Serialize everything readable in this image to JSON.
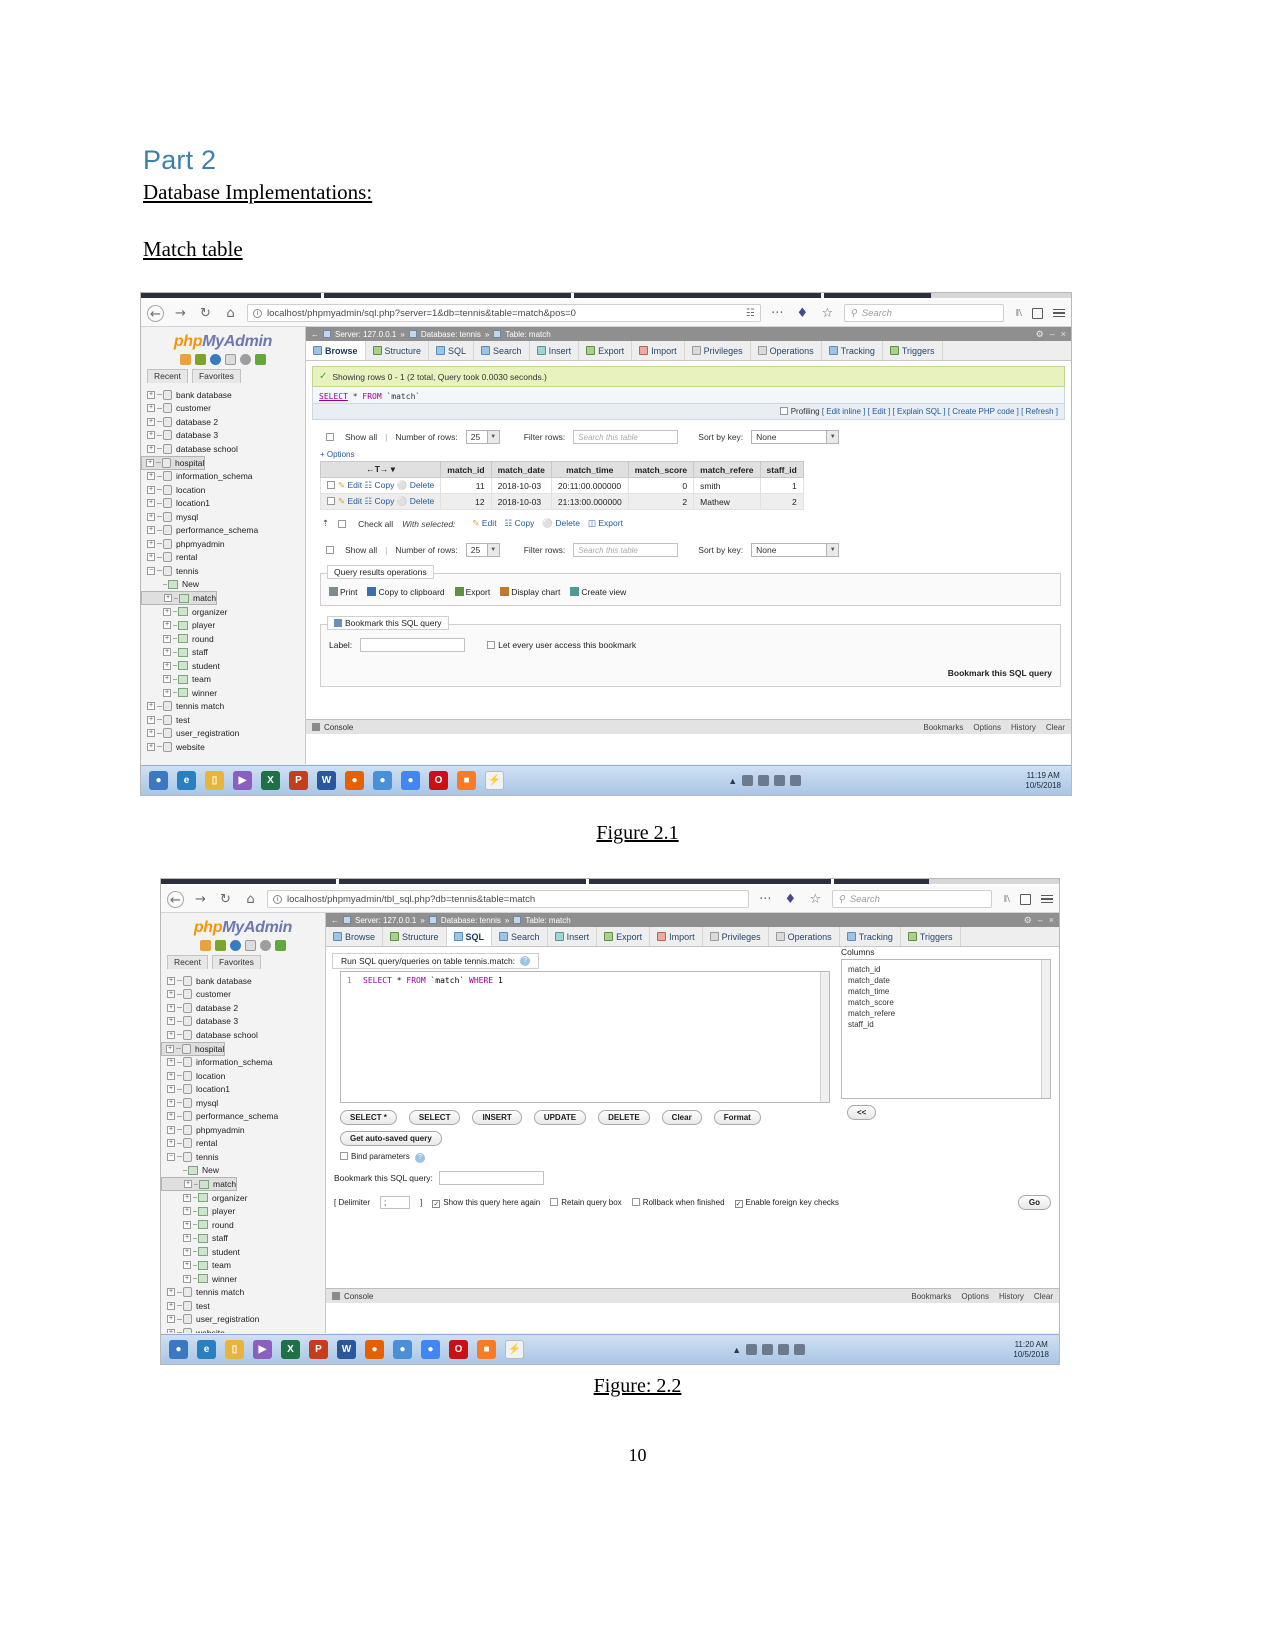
{
  "document": {
    "part_title": "Part 2",
    "section_heading": "Database Implementations:",
    "subsection_heading": "Match table",
    "figure1_caption": "Figure 2.1",
    "figure2_caption": "Figure: 2.2",
    "page_number": "10"
  },
  "figure1": {
    "browser": {
      "back_icon": "←",
      "forward_icon": "→",
      "reload_icon": "↻",
      "home_icon": "⌂",
      "info_icon": "i",
      "url": "localhost/phpmyadmin/sql.php?server=1&db=tennis&table=match&pos=0",
      "reader_icon": "☷",
      "more_icon": "···",
      "shield_icon": "♦",
      "star_icon": "☆",
      "search_icon": "⚲",
      "search_placeholder": "Search",
      "library_icon": "‖\\",
      "sync_icon": "▣",
      "menu_icon": "hamburger"
    },
    "sidebar": {
      "logo_left": "php",
      "logo_right": "MyAdmin",
      "recent_label": "Recent",
      "favorites_label": "Favorites",
      "databases": [
        "bank database",
        "customer",
        "database 2",
        "database 3",
        "database school",
        "hospital",
        "information_schema",
        "location",
        "location1",
        "mysql",
        "performance_schema",
        "phpmyadmin",
        "rental",
        "tennis"
      ],
      "selected_database": "hospital",
      "tennis_tables": [
        "New",
        "match",
        "organizer",
        "player",
        "round",
        "staff",
        "student",
        "team",
        "winner"
      ],
      "selected_table": "match",
      "databases_after": [
        "tennis match",
        "test",
        "user_registration",
        "website"
      ]
    },
    "breadcrumb": {
      "back_arrow": "←",
      "server_label": "Server: 127.0.0.1",
      "sep1": "»",
      "database_label": "Database: tennis",
      "sep2": "»",
      "table_label": "Table: match",
      "gear_icon": "⚙",
      "minimize_icon": "–",
      "close_icon": "×"
    },
    "tabs": [
      {
        "label": "Browse",
        "active": true
      },
      {
        "label": "Structure",
        "active": false
      },
      {
        "label": "SQL",
        "active": false
      },
      {
        "label": "Search",
        "active": false
      },
      {
        "label": "Insert",
        "active": false
      },
      {
        "label": "Export",
        "active": false
      },
      {
        "label": "Import",
        "active": false
      },
      {
        "label": "Privileges",
        "active": false
      },
      {
        "label": "Operations",
        "active": false
      },
      {
        "label": "Tracking",
        "active": false
      },
      {
        "label": "Triggers",
        "active": false
      }
    ],
    "status_message": "Showing rows 0 - 1 (2 total, Query took 0.0030 seconds.)",
    "sql_query": {
      "select": "SELECT",
      "star": "*",
      "from": "FROM",
      "table": "`match`"
    },
    "query_actions": {
      "profiling_label": "Profiling",
      "links": [
        "[ Edit inline ]",
        "[ Edit ]",
        "[ Explain SQL ]",
        "[ Create PHP code ]",
        "[ Refresh ]"
      ]
    },
    "controls": {
      "show_all_label": "Show all",
      "number_of_rows_label": "Number of rows:",
      "number_of_rows_value": "25",
      "filter_rows_label": "Filter rows:",
      "filter_rows_placeholder": "Search this table",
      "sort_by_key_label": "Sort by key:",
      "sort_by_key_value": "None",
      "options_label": "+ Options"
    },
    "table": {
      "headers": [
        "match_id",
        "match_date",
        "match_time",
        "match_score",
        "match_refere",
        "staff_id"
      ],
      "row_action_labels": [
        "Edit",
        "Copy",
        "Delete"
      ],
      "rows": [
        [
          "11",
          "2018-10-03",
          "20:11:00.000000",
          "0",
          "smith",
          "1"
        ],
        [
          "12",
          "2018-10-03",
          "21:13:00.000000",
          "2",
          "Mathew",
          "2"
        ]
      ]
    },
    "with_selected": {
      "check_all_label": "Check all",
      "with_selected_label": "With selected:",
      "actions": [
        "Edit",
        "Copy",
        "Delete",
        "Export"
      ]
    },
    "query_results_operations": {
      "legend": "Query results operations",
      "items": [
        "Print",
        "Copy to clipboard",
        "Export",
        "Display chart",
        "Create view"
      ]
    },
    "bookmark": {
      "legend": "Bookmark this SQL query",
      "label_text": "Label:",
      "label_value": "",
      "checkbox_label": "Let every user access this bookmark",
      "submit_label": "Bookmark this SQL query"
    },
    "console": {
      "label": "Console",
      "links": [
        "Bookmarks",
        "Options",
        "History",
        "Clear"
      ]
    },
    "taskbar": {
      "time": "11:19 AM",
      "date": "10/5/2018"
    }
  },
  "figure2": {
    "browser": {
      "back_icon": "←",
      "forward_icon": "→",
      "reload_icon": "↻",
      "home_icon": "⌂",
      "info_icon": "i",
      "url": "localhost/phpmyadmin/tbl_sql.php?db=tennis&table=match",
      "more_icon": "···",
      "shield_icon": "♦",
      "star_icon": "☆",
      "search_icon": "⚲",
      "search_placeholder": "Search",
      "library_icon": "‖\\",
      "sync_icon": "▣",
      "menu_icon": "hamburger"
    },
    "sidebar": {
      "logo_left": "php",
      "logo_right": "MyAdmin",
      "recent_label": "Recent",
      "favorites_label": "Favorites",
      "databases": [
        "bank database",
        "customer",
        "database 2",
        "database 3",
        "database school",
        "hospital",
        "information_schema",
        "location",
        "location1",
        "mysql",
        "performance_schema",
        "phpmyadmin",
        "rental",
        "tennis"
      ],
      "selected_database": "hospital",
      "tennis_tables": [
        "New",
        "match",
        "organizer",
        "player",
        "round",
        "staff",
        "student",
        "team",
        "winner"
      ],
      "selected_table": "match",
      "databases_after": [
        "tennis match",
        "test",
        "user_registration",
        "website"
      ]
    },
    "breadcrumb": {
      "back_arrow": "←",
      "server_label": "Server: 127.0.0.1",
      "sep1": "»",
      "database_label": "Database: tennis",
      "sep2": "»",
      "table_label": "Table: match",
      "gear_icon": "⚙",
      "minimize_icon": "–",
      "close_icon": "×"
    },
    "tabs": [
      {
        "label": "Browse",
        "active": false
      },
      {
        "label": "Structure",
        "active": false
      },
      {
        "label": "SQL",
        "active": true
      },
      {
        "label": "Search",
        "active": false
      },
      {
        "label": "Insert",
        "active": false
      },
      {
        "label": "Export",
        "active": false
      },
      {
        "label": "Import",
        "active": false
      },
      {
        "label": "Privileges",
        "active": false
      },
      {
        "label": "Operations",
        "active": false
      },
      {
        "label": "Tracking",
        "active": false
      },
      {
        "label": "Triggers",
        "active": false
      }
    ],
    "run_panel": {
      "title": "Run SQL query/queries on table tennis.match:",
      "help_icon": "?"
    },
    "editor": {
      "line_number": "1",
      "query_keyword": "SELECT",
      "query_star": "*",
      "query_from": "FROM",
      "query_table": "`match`",
      "query_where": "WHERE",
      "query_value": "1"
    },
    "query_buttons": [
      "SELECT *",
      "SELECT",
      "INSERT",
      "UPDATE",
      "DELETE",
      "Clear",
      "Format"
    ],
    "autosave_button": "Get auto-saved query",
    "bind_parameters_label": "Bind parameters",
    "columns_panel": {
      "title": "Columns",
      "items": [
        "match_id",
        "match_date",
        "match_time",
        "match_score",
        "match_refere",
        "staff_id"
      ],
      "collapse_button": "<<"
    },
    "bookmark_row": {
      "label": "Bookmark this SQL query:",
      "value": ""
    },
    "bottom_options": {
      "delimiter_label": "[ Delimiter",
      "delimiter_value": ";",
      "delimiter_close": "]",
      "show_query_label": "Show this query here again",
      "retain_label": "Retain query box",
      "rollback_label": "Rollback when finished",
      "foreign_key_label": "Enable foreign key checks",
      "go_label": "Go",
      "checked_mark": "✓"
    },
    "console": {
      "label": "Console",
      "links": [
        "Bookmarks",
        "Options",
        "History",
        "Clear"
      ]
    },
    "taskbar": {
      "time": "11:20 AM",
      "date": "10/5/2018"
    }
  }
}
